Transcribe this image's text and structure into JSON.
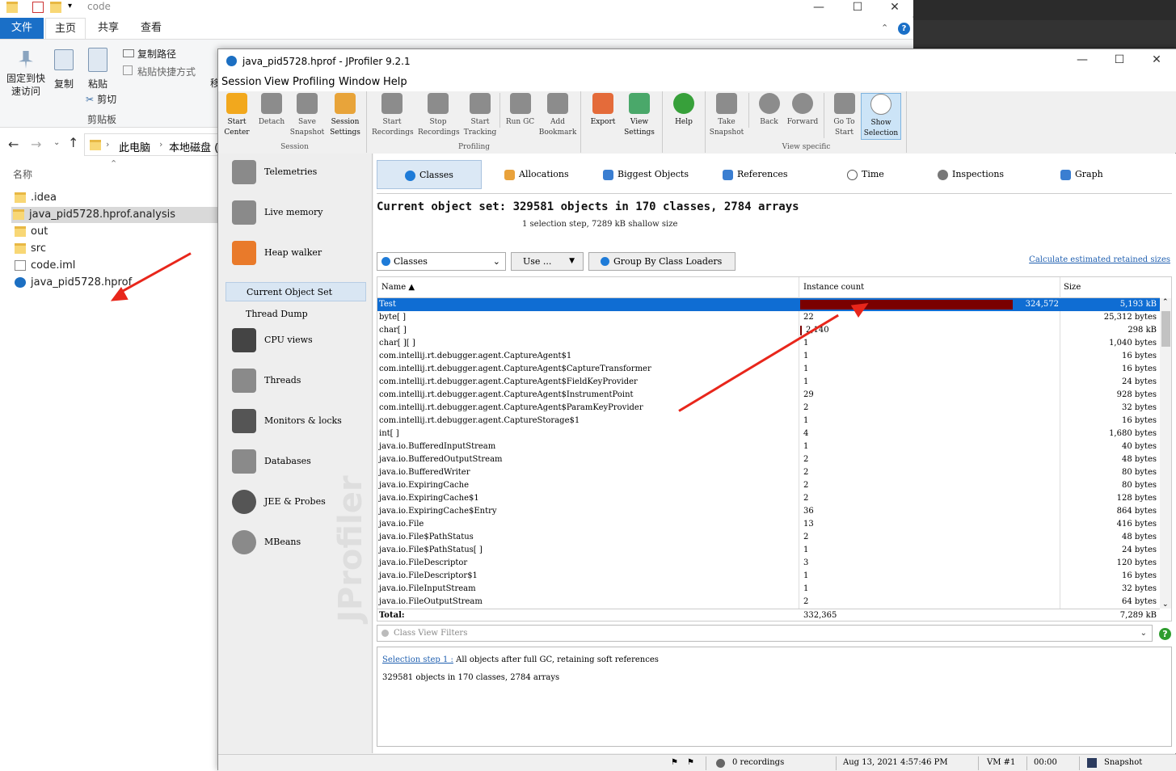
{
  "explorer": {
    "title": "code",
    "tabs": [
      "文件",
      "主页",
      "共享",
      "查看"
    ],
    "ribbon": {
      "pin": "固定到快\n速访问",
      "copy": "复制",
      "paste": "粘贴",
      "copy_path": "复制路径",
      "paste_shortcut": "粘贴快捷方式",
      "cut": "剪切",
      "group_clipboard": "剪贴板",
      "move_to": "移"
    },
    "breadcrumb": [
      "此电脑",
      "本地磁盘 (D"
    ],
    "column_header": "名称",
    "items": [
      {
        "name": ".idea",
        "type": "folder"
      },
      {
        "name": "java_pid5728.hprof.analysis",
        "type": "folder"
      },
      {
        "name": "out",
        "type": "folder"
      },
      {
        "name": "src",
        "type": "folder"
      },
      {
        "name": "code.iml",
        "type": "file"
      },
      {
        "name": "java_pid5728.hprof",
        "type": "jprofiler"
      }
    ]
  },
  "jprofiler": {
    "title": "java_pid5728.hprof - JProfiler 9.2.1",
    "menu": [
      "Session",
      "View",
      "Profiling",
      "Window",
      "Help"
    ],
    "toolbar": {
      "groups": [
        "Session",
        "Profiling",
        "View specific"
      ],
      "buttons": [
        {
          "label": "Start\nCenter",
          "icon": "folder-open-icon"
        },
        {
          "label": "Detach",
          "icon": "detach-icon"
        },
        {
          "label": "Save\nSnapshot",
          "icon": "save-icon"
        },
        {
          "label": "Session\nSettings",
          "icon": "settings-clipboard-icon"
        },
        {
          "label": "Start\nRecordings",
          "icon": "start-recordings-icon"
        },
        {
          "label": "Stop\nRecordings",
          "icon": "stop-recordings-icon"
        },
        {
          "label": "Start\nTracking",
          "icon": "start-tracking-icon"
        },
        {
          "label": "Run GC",
          "icon": "run-gc-icon"
        },
        {
          "label": "Add\nBookmark",
          "icon": "bookmark-icon"
        },
        {
          "label": "Export",
          "icon": "export-icon"
        },
        {
          "label": "View\nSettings",
          "icon": "view-settings-icon"
        },
        {
          "label": "Help",
          "icon": "help-icon"
        },
        {
          "label": "Take\nSnapshot",
          "icon": "camera-icon"
        },
        {
          "label": "Back",
          "icon": "back-icon"
        },
        {
          "label": "Forward",
          "icon": "forward-icon"
        },
        {
          "label": "Go To\nStart",
          "icon": "home-icon"
        },
        {
          "label": "Show\nSelection",
          "icon": "show-selection-icon"
        }
      ]
    },
    "nav": {
      "items": [
        "Telemetries",
        "Live memory",
        "Heap walker"
      ],
      "sub": [
        "Current Object Set",
        "Thread Dump"
      ],
      "items2": [
        "CPU views",
        "Threads",
        "Monitors & locks",
        "Databases",
        "JEE & Probes",
        "MBeans"
      ],
      "watermark": "JProfiler"
    },
    "view_tabs": [
      "Classes",
      "Allocations",
      "Biggest Objects",
      "References",
      "Time",
      "Inspections",
      "Graph"
    ],
    "current_object_set": "Current object set: 329581 objects in 170 classes, 2784 arrays",
    "selection_info": "1 selection step, 7289 kB shallow size",
    "controls": {
      "classes_select": "Classes",
      "use_button": "Use ...",
      "group_button": "Group By Class Loaders",
      "calc_link": "Calculate estimated retained sizes"
    },
    "table": {
      "headers": [
        "Name",
        "Instance count",
        "Size"
      ],
      "rows": [
        {
          "name": "Test",
          "count": "324,572",
          "size": "5,193 kB",
          "bar": 0.98
        },
        {
          "name": "byte[ ]",
          "count": "22",
          "size": "25,312 bytes",
          "bar": 0
        },
        {
          "name": "char[ ]",
          "count": "2,140",
          "size": "298 kB",
          "bar": 0.006
        },
        {
          "name": "char[ ][ ]",
          "count": "1",
          "size": "1,040 bytes",
          "bar": 0
        },
        {
          "name": "com.intellij.rt.debugger.agent.CaptureAgent$1",
          "count": "1",
          "size": "16 bytes",
          "bar": 0
        },
        {
          "name": "com.intellij.rt.debugger.agent.CaptureAgent$CaptureTransformer",
          "count": "1",
          "size": "16 bytes",
          "bar": 0
        },
        {
          "name": "com.intellij.rt.debugger.agent.CaptureAgent$FieldKeyProvider",
          "count": "1",
          "size": "24 bytes",
          "bar": 0
        },
        {
          "name": "com.intellij.rt.debugger.agent.CaptureAgent$InstrumentPoint",
          "count": "29",
          "size": "928 bytes",
          "bar": 0
        },
        {
          "name": "com.intellij.rt.debugger.agent.CaptureAgent$ParamKeyProvider",
          "count": "2",
          "size": "32 bytes",
          "bar": 0
        },
        {
          "name": "com.intellij.rt.debugger.agent.CaptureStorage$1",
          "count": "1",
          "size": "16 bytes",
          "bar": 0
        },
        {
          "name": "int[ ]",
          "count": "4",
          "size": "1,680 bytes",
          "bar": 0
        },
        {
          "name": "java.io.BufferedInputStream",
          "count": "1",
          "size": "40 bytes",
          "bar": 0
        },
        {
          "name": "java.io.BufferedOutputStream",
          "count": "2",
          "size": "48 bytes",
          "bar": 0
        },
        {
          "name": "java.io.BufferedWriter",
          "count": "2",
          "size": "80 bytes",
          "bar": 0
        },
        {
          "name": "java.io.ExpiringCache",
          "count": "2",
          "size": "80 bytes",
          "bar": 0
        },
        {
          "name": "java.io.ExpiringCache$1",
          "count": "2",
          "size": "128 bytes",
          "bar": 0
        },
        {
          "name": "java.io.ExpiringCache$Entry",
          "count": "36",
          "size": "864 bytes",
          "bar": 0
        },
        {
          "name": "java.io.File",
          "count": "13",
          "size": "416 bytes",
          "bar": 0
        },
        {
          "name": "java.io.File$PathStatus",
          "count": "2",
          "size": "48 bytes",
          "bar": 0
        },
        {
          "name": "java.io.File$PathStatus[ ]",
          "count": "1",
          "size": "24 bytes",
          "bar": 0
        },
        {
          "name": "java.io.FileDescriptor",
          "count": "3",
          "size": "120 bytes",
          "bar": 0
        },
        {
          "name": "java.io.FileDescriptor$1",
          "count": "1",
          "size": "16 bytes",
          "bar": 0
        },
        {
          "name": "java.io.FileInputStream",
          "count": "1",
          "size": "32 bytes",
          "bar": 0
        },
        {
          "name": "java.io.FileOutputStream",
          "count": "2",
          "size": "64 bytes",
          "bar": 0
        }
      ],
      "total_label": "Total:",
      "total_count": "332,365",
      "total_size": "7,289 kB"
    },
    "filter_placeholder": "Class View Filters",
    "info": {
      "link": "Selection step 1 :",
      "text": "All objects after full GC, retaining soft references",
      "line2": "329581 objects in 170 classes, 2784 arrays"
    },
    "status": {
      "recordings": "0 recordings",
      "datetime": "Aug 13, 2021 4:57:46 PM",
      "vm": "VM #1",
      "time": "00:00",
      "mode": "Snapshot"
    }
  },
  "colors": {
    "selection_blue": "#0f6dd3",
    "bar": "#7a0000",
    "arrow": "#e8261b",
    "explorer_accent": "#1a6fc7"
  }
}
